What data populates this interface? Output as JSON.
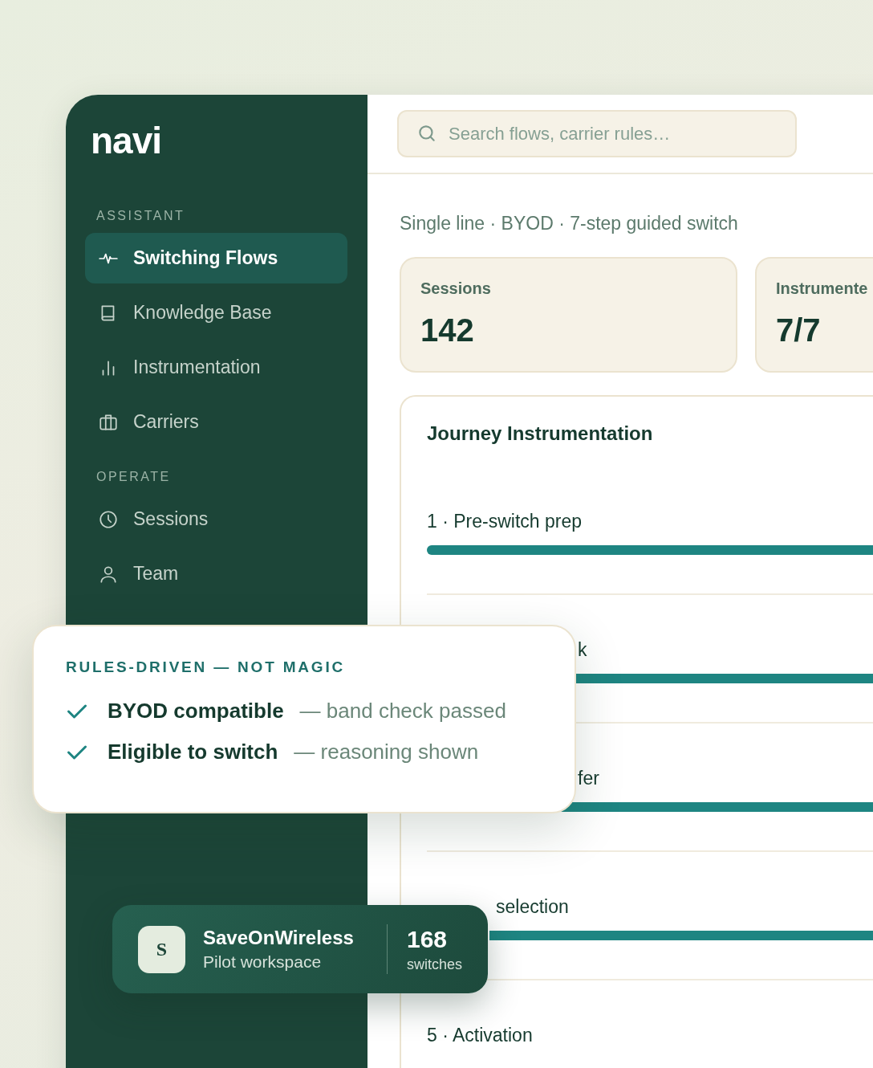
{
  "logo": "navi",
  "search": {
    "placeholder": "Search flows, carrier rules…"
  },
  "sidebar": {
    "sections": [
      {
        "label": "ASSISTANT",
        "items": [
          {
            "label": "Switching Flows",
            "selected": true
          },
          {
            "label": "Knowledge Base",
            "selected": false
          },
          {
            "label": "Instrumentation",
            "selected": false
          },
          {
            "label": "Carriers",
            "selected": false
          }
        ]
      },
      {
        "label": "OPERATE",
        "items": [
          {
            "label": "Sessions",
            "selected": false
          },
          {
            "label": "Team",
            "selected": false
          }
        ]
      }
    ]
  },
  "subtitle": "Single line · BYOD · 7-step guided switch",
  "stats": [
    {
      "label": "Sessions",
      "value": "142"
    },
    {
      "label": "Instrumente",
      "value": "7/7"
    }
  ],
  "journey": {
    "title": "Journey Instrumentation",
    "steps": [
      {
        "label": "1 · Pre-switch prep",
        "kind": "full",
        "level": 1
      },
      {
        "label": "k",
        "kind": "behind-note",
        "level": 1
      },
      {
        "label": "fer",
        "kind": "behind-note",
        "level": 1
      },
      {
        "label": "selection",
        "kind": "behind-badge",
        "level": 1
      },
      {
        "label": "5 · Activation",
        "kind": "full"
      }
    ]
  },
  "note": {
    "title": "RULES-DRIVEN — NOT MAGIC",
    "checks": [
      {
        "label": "BYOD compatible",
        "detail": "— band check passed",
        "checked": true
      },
      {
        "label": "Eligible to switch",
        "detail": "— reasoning shown",
        "checked": true
      }
    ]
  },
  "workspace": {
    "initial": "S",
    "name": "SaveOnWireless",
    "subtitle": "Pilot workspace",
    "count": "168",
    "count_label": "switches"
  }
}
